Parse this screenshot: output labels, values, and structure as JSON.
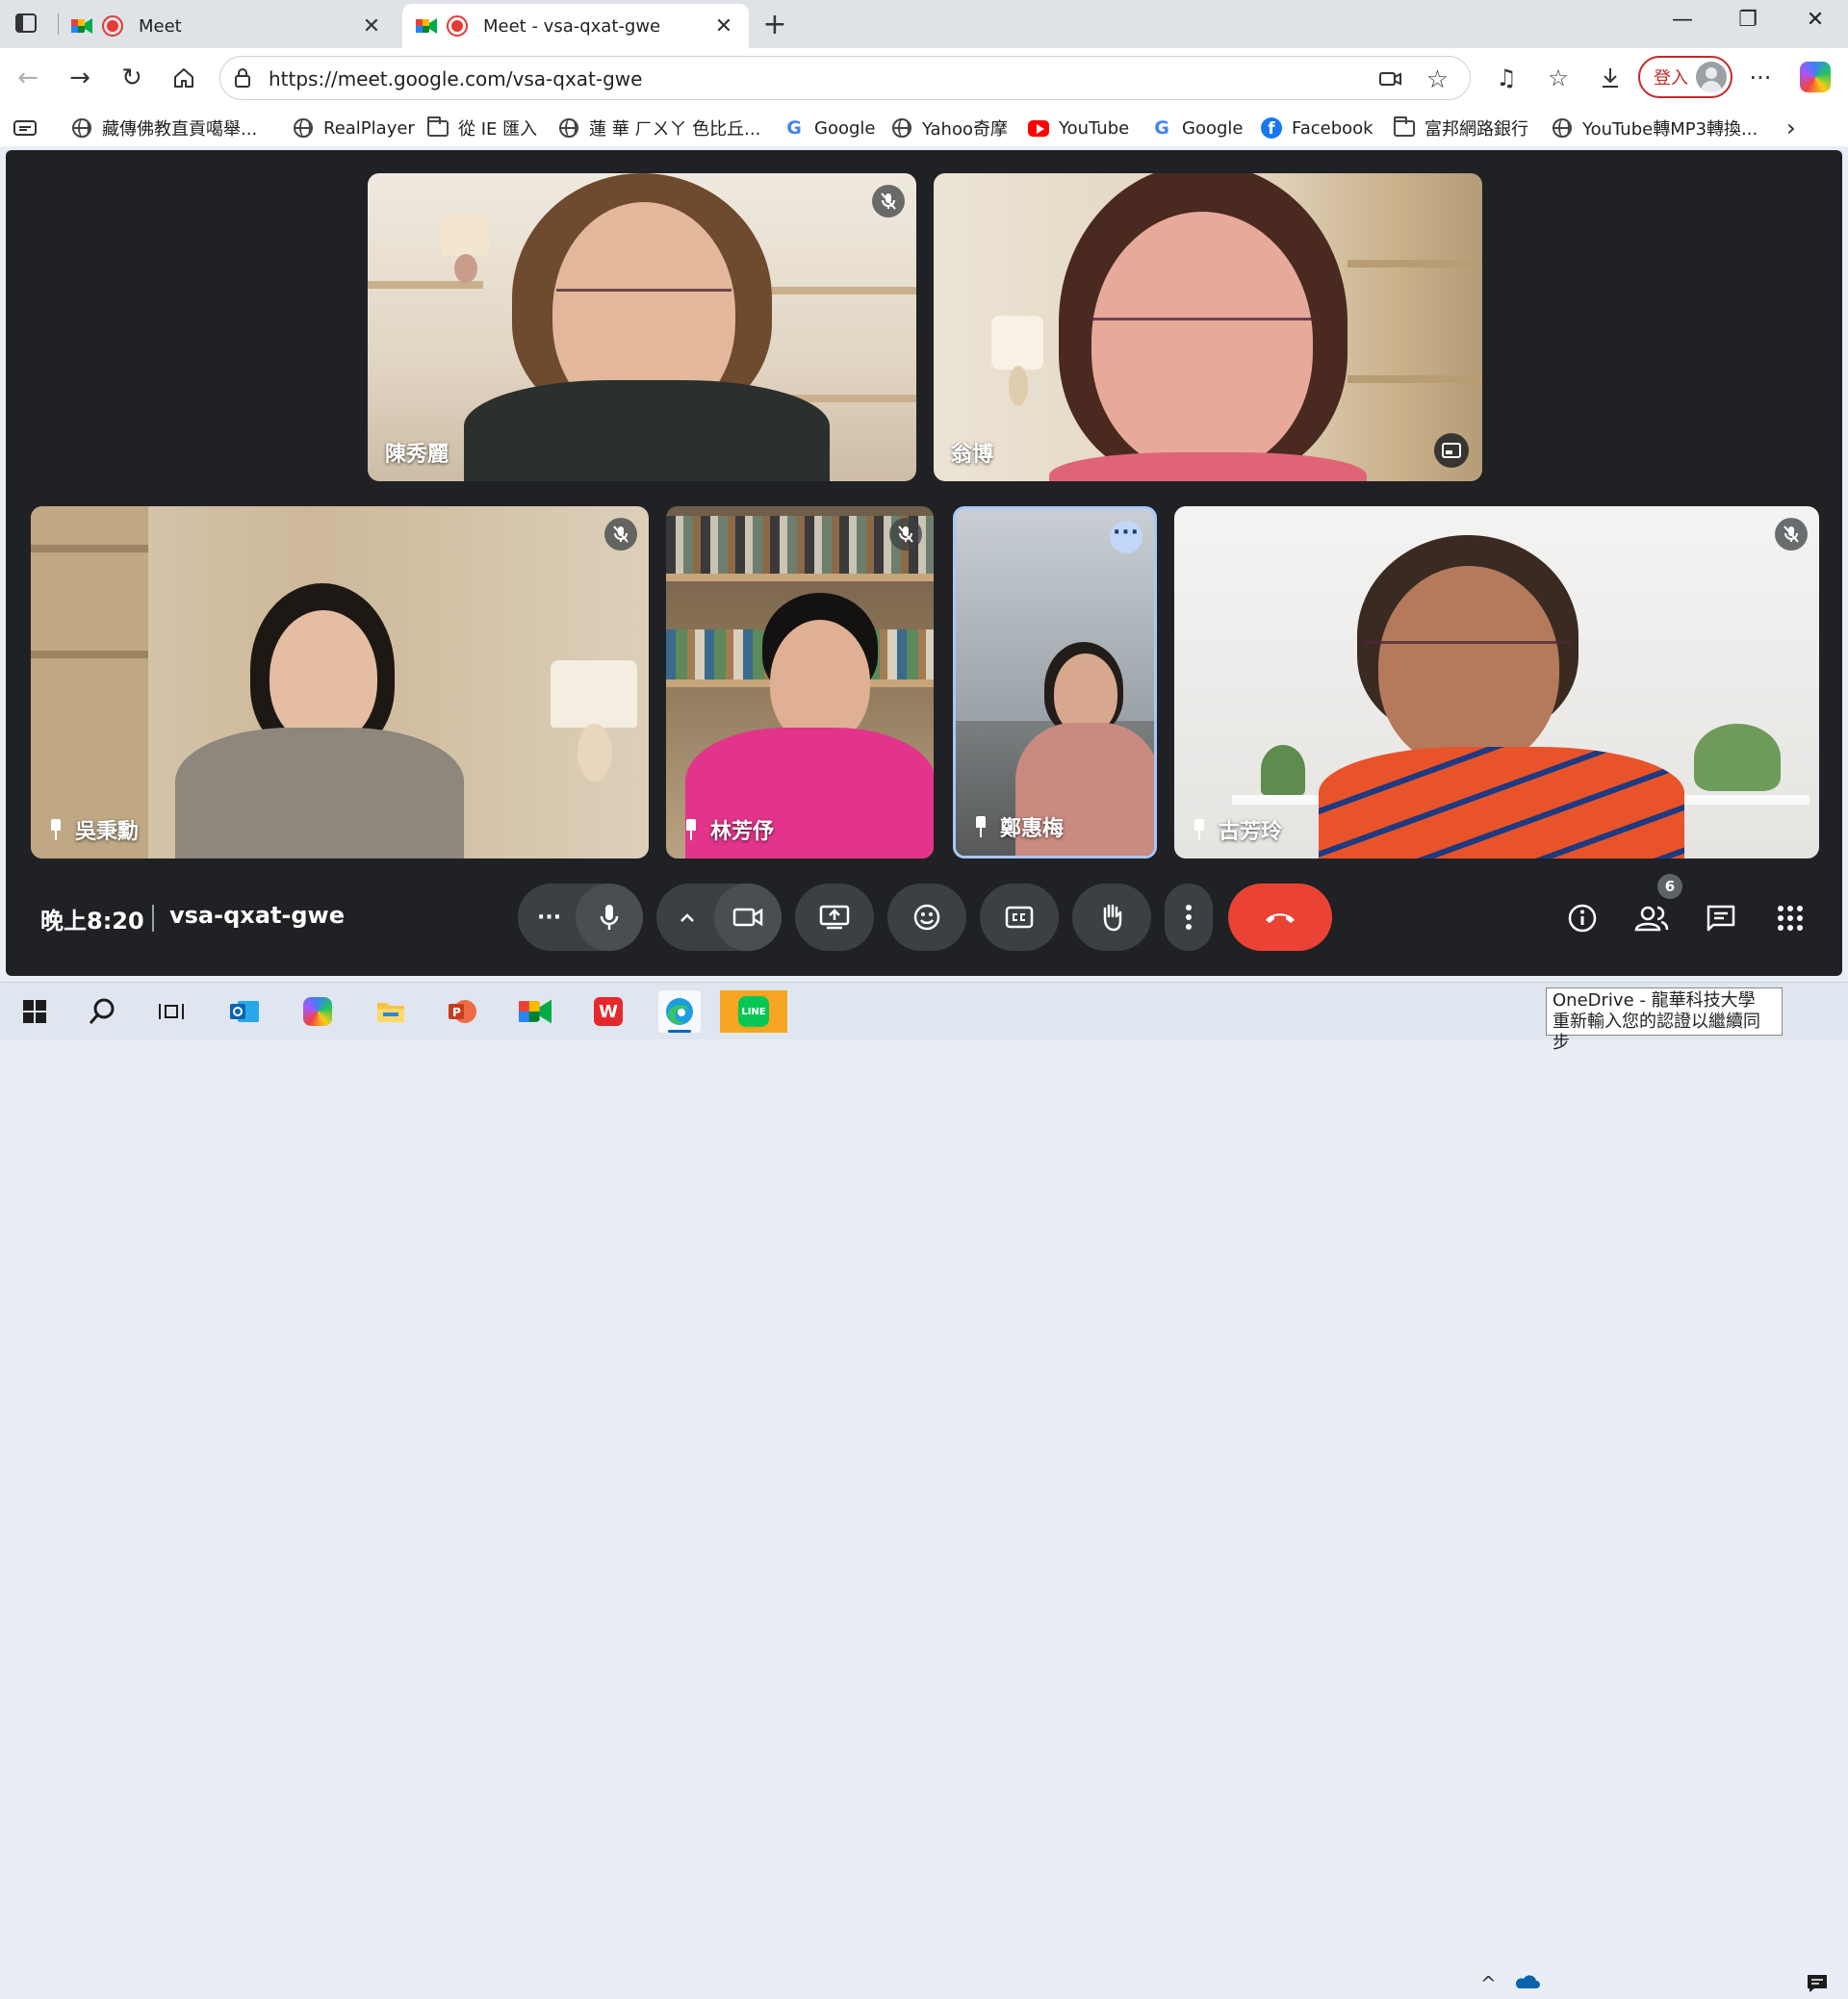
{
  "browser": {
    "tabs": [
      {
        "title": "Meet",
        "active": false
      },
      {
        "title": "Meet - vsa-qxat-gwe",
        "active": true
      }
    ],
    "new_tab_symbol": "+",
    "window_controls": [
      "—",
      "❐",
      "✕"
    ],
    "url": "https://meet.google.com/vsa-qxat-gwe",
    "sign_in_label": "登入",
    "more_symbol": "···",
    "bookmarks": [
      {
        "label": "藏傳佛教直貢噶舉...",
        "icon": "globe-icon"
      },
      {
        "label": "RealPlayer",
        "icon": "globe-icon"
      },
      {
        "label": "從 IE 匯入",
        "icon": "folder-icon"
      },
      {
        "label": "蓮 華 ㄏㄨㄚ 色比丘...",
        "icon": "globe-icon"
      },
      {
        "label": "Google",
        "icon": "google-icon"
      },
      {
        "label": "Yahoo奇摩",
        "icon": "globe-icon"
      },
      {
        "label": "YouTube",
        "icon": "youtube-icon"
      },
      {
        "label": "Google",
        "icon": "google-icon"
      },
      {
        "label": "Facebook",
        "icon": "facebook-icon"
      },
      {
        "label": "富邦網路銀行",
        "icon": "folder-icon"
      },
      {
        "label": "YouTube轉MP3轉換...",
        "icon": "globe-icon"
      }
    ]
  },
  "meet": {
    "participants": [
      {
        "name": "陳秀麗",
        "muted": true,
        "pinned": false
      },
      {
        "name": "翁博",
        "muted": false,
        "pinned": false
      },
      {
        "name": "吳秉勳",
        "muted": true,
        "pinned": true
      },
      {
        "name": "林芳伃",
        "muted": true,
        "pinned": true
      },
      {
        "name": "鄭惠梅",
        "muted": false,
        "pinned": true
      },
      {
        "name": "古芳玲",
        "muted": true,
        "pinned": true
      }
    ],
    "time": "晚上8:20",
    "meeting_code": "vsa-qxat-gwe",
    "participant_count": "6",
    "colors": {
      "end_call": "#ea4335",
      "background": "#202124",
      "control": "#3c4043"
    }
  },
  "taskbar": {
    "onedrive_line1": "OneDrive  - 龍華科技大學",
    "onedrive_line2": "重新輸入您的認證以繼續同步"
  }
}
